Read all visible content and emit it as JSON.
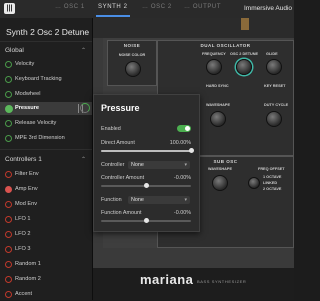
{
  "header": {
    "logo": "|||",
    "tabs": [
      {
        "label": "… OSC 1"
      },
      {
        "label": "SYNTH 2"
      },
      {
        "label": "… OSC 2"
      },
      {
        "label": "… OUTPUT"
      }
    ],
    "brand": "Immersive Audio D"
  },
  "sidebar": {
    "title": "Synth 2 Osc 2 Detune",
    "group_global": "Global",
    "global_items": [
      {
        "label": "Velocity"
      },
      {
        "label": "Keyboard Tracking"
      },
      {
        "label": "Modwheel"
      },
      {
        "label": "Pressure"
      },
      {
        "label": "Release Velocity"
      },
      {
        "label": "MPE 3rd Dimension"
      }
    ],
    "group_controllers": "Controllers 1",
    "controller_items": [
      {
        "label": "Filter Env"
      },
      {
        "label": "Amp Env"
      },
      {
        "label": "Mod Env"
      },
      {
        "label": "LFO 1"
      },
      {
        "label": "LFO 2"
      },
      {
        "label": "LFO 3"
      },
      {
        "label": "Random 1"
      },
      {
        "label": "Random 2"
      },
      {
        "label": "Accent"
      }
    ]
  },
  "synth": {
    "noise_title": "NOISE",
    "dual_osc_title": "DUAL OSCILLATOR",
    "sub_osc_title": "SUB OSC",
    "labels": {
      "noise_color": "NOISE COLOR",
      "frequency": "FREQUENCY",
      "osc2_detune": "OSC 2 DETUNE",
      "glide": "GLIDE",
      "hard_sync": "HARD SYNC",
      "key_reset": "KEY RESET",
      "waveshape": "WAVESHAPE",
      "duty_cycle": "DUTY CYCLE",
      "sub_waveshape": "WAVESHAPE",
      "freq_offset": "FREQ OFFSET",
      "octave_1": "1 OCTAVE",
      "linked": "LINKED",
      "octave_2": "2 OCTAVE"
    },
    "name": "mariana",
    "subtitle": "BASS SYNTHESIZER"
  },
  "popup": {
    "title": "Pressure",
    "enabled_label": "Enabled",
    "enabled": true,
    "direct_amount_label": "Direct Amount",
    "direct_amount_value": "100.00%",
    "direct_amount": 1.0,
    "controller_label": "Controller",
    "controller_value": "None",
    "controller_amount_label": "Controller Amount",
    "controller_amount_value": "-0.00%",
    "controller_amount": 0.0,
    "function_label": "Function",
    "function_value": "None",
    "function_amount_label": "Function Amount",
    "function_amount_value": "-0.00%",
    "function_amount": 0.0
  },
  "colors": {
    "accent_green": "#4caf50",
    "tab_underline": "#4a8ee6",
    "knob_highlight": "#3fb7a6"
  }
}
